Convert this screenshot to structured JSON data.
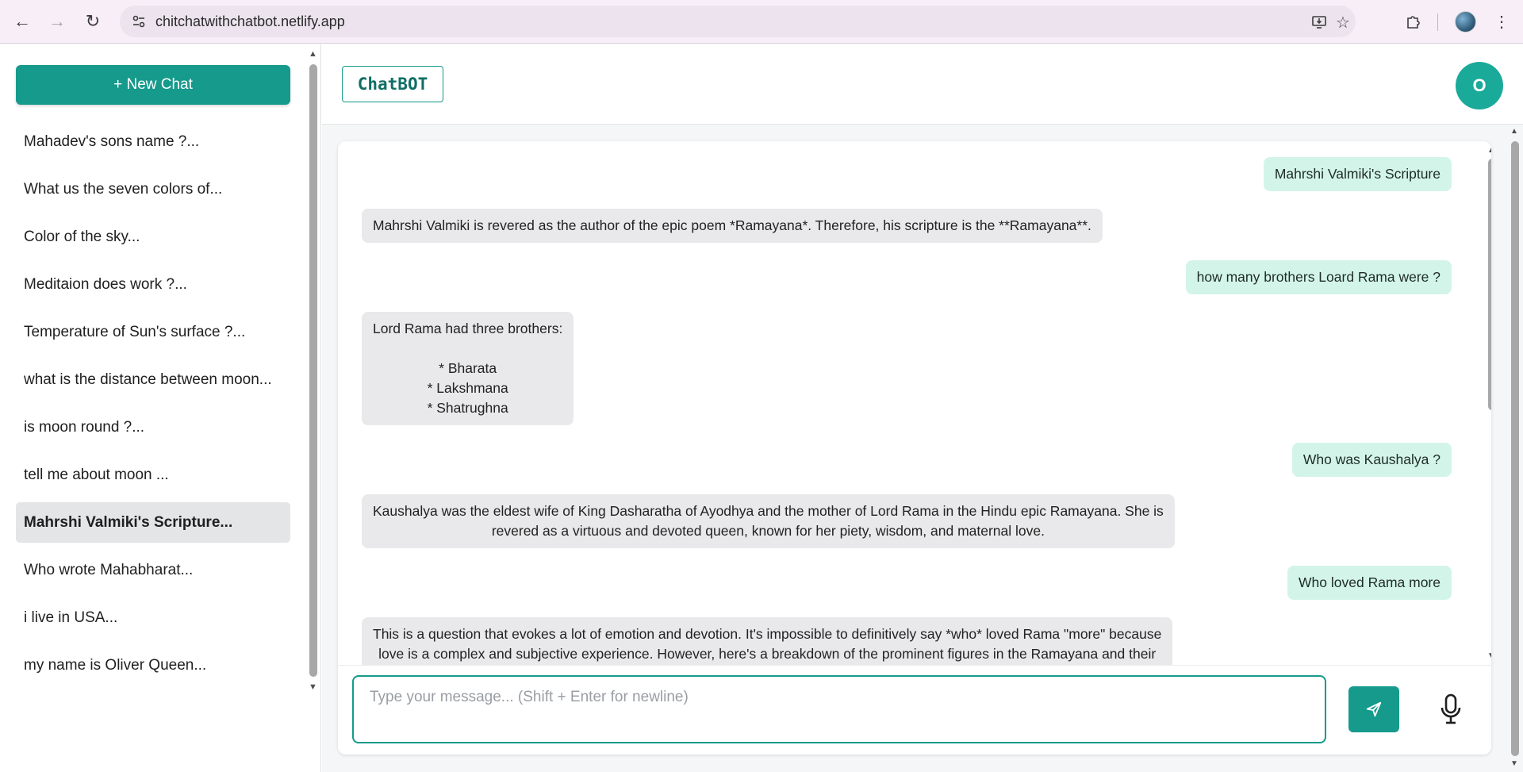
{
  "browser": {
    "url": "chitchatwithchatbot.netlify.app"
  },
  "sidebar": {
    "new_chat_label": "+ New Chat",
    "items": [
      {
        "label": "Mahadev's sons name ?..."
      },
      {
        "label": "What us the seven colors of..."
      },
      {
        "label": "Color of the sky..."
      },
      {
        "label": "Meditaion does work ?..."
      },
      {
        "label": "Temperature of Sun's surface ?..."
      },
      {
        "label": "what is the distance between moon..."
      },
      {
        "label": "is moon round ?..."
      },
      {
        "label": "tell me about moon ..."
      },
      {
        "label": "Mahrshi Valmiki's Scripture...",
        "active": true
      },
      {
        "label": "Who wrote Mahabharat..."
      },
      {
        "label": "i live in USA..."
      },
      {
        "label": "my name is Oliver Queen..."
      }
    ]
  },
  "header": {
    "logo": "ChatBOT",
    "avatar_initial": "O"
  },
  "messages": [
    {
      "role": "user",
      "text": "Mahrshi Valmiki's Scripture"
    },
    {
      "role": "bot",
      "text": "Mahrshi Valmiki is revered as the author of the epic poem *Ramayana*. Therefore, his scripture is the **Ramayana**."
    },
    {
      "role": "user",
      "text": "how many brothers Loard Rama were ?"
    },
    {
      "role": "bot",
      "lines": [
        "Lord Rama had three brothers:",
        "",
        "*   Bharata",
        "*   Lakshmana",
        "*   Shatrughna"
      ]
    },
    {
      "role": "user",
      "text": "Who was Kaushalya ?"
    },
    {
      "role": "bot",
      "lines": [
        "Kaushalya was the eldest wife of King Dasharatha of Ayodhya and the mother of Lord Rama in the Hindu epic Ramayana. She is",
        "revered as a virtuous and devoted queen, known for her piety, wisdom, and maternal love."
      ]
    },
    {
      "role": "user",
      "text": "Who loved Rama more"
    },
    {
      "role": "bot",
      "lines": [
        "This is a question that evokes a lot of emotion and devotion. It's impossible to definitively say *who* loved Rama \"more\" because",
        "love is a complex and subjective experience. However, here's a breakdown of the prominent figures in the Ramayana and their"
      ]
    }
  ],
  "input": {
    "placeholder": "Type your message... (Shift + Enter for newline)"
  },
  "colors": {
    "accent": "#159a8c",
    "user_bubble": "#d3f5e9",
    "bot_bubble": "#e9e9eb"
  }
}
